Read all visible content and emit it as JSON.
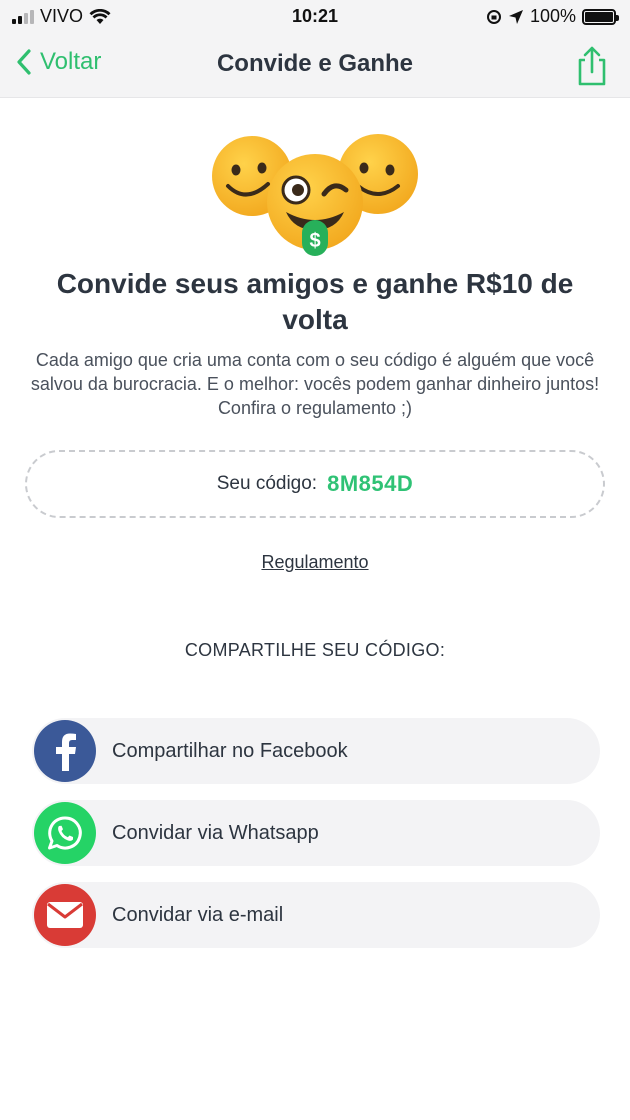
{
  "status_bar": {
    "carrier": "VIVO",
    "time": "10:21",
    "battery": "100%"
  },
  "nav": {
    "back_label": "Voltar",
    "title": "Convide e Ganhe",
    "share_icon": "share-icon"
  },
  "hero": {
    "icons": [
      "smiling-emoji-icon",
      "winking-tongue-money-emoji-icon",
      "smiling-emoji-icon"
    ],
    "money_symbol": "$"
  },
  "headline": "Convide seus amigos e ganhe R$10 de volta",
  "description": "Cada amigo que cria uma conta com o seu código é alguém que você salvou da burocracia. E o melhor: vocês podem ganhar dinheiro juntos! Confira o regulamento ;)",
  "code": {
    "label": "Seu código:",
    "value": "8M854D"
  },
  "regulation_link": "Regulamento",
  "share_heading": "COMPARTILHE SEU CÓDIGO:",
  "share_buttons": [
    {
      "label": "Compartilhar no Facebook",
      "icon": "facebook-icon",
      "color": "#3b5998"
    },
    {
      "label": "Convidar via Whatsapp",
      "icon": "whatsapp-icon",
      "color": "#25d366"
    },
    {
      "label": "Convidar via e-mail",
      "icon": "email-icon",
      "color": "#d93b36"
    }
  ],
  "colors": {
    "accent": "#2fbf6f",
    "text": "#2d3540",
    "button_bg": "#f3f3f5"
  }
}
